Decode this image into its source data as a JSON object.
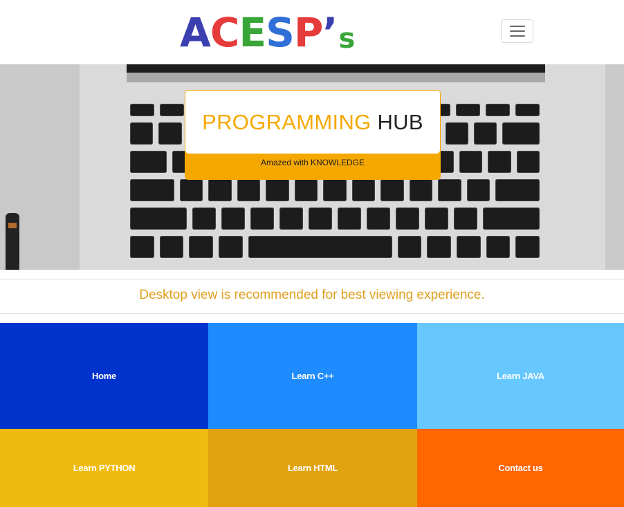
{
  "header": {
    "logo": {
      "letters": [
        {
          "char": "A",
          "color": "#3c3fb0"
        },
        {
          "char": "C",
          "color": "#e63b3b"
        },
        {
          "char": "E",
          "color": "#3aa63a"
        },
        {
          "char": "S",
          "color": "#2f6fd6"
        },
        {
          "char": "P",
          "color": "#e63b3b"
        },
        {
          "char": "’",
          "color": "#3c3fb0"
        },
        {
          "char": "s",
          "color": "#3aa63a"
        }
      ],
      "text": "ACESP’s"
    },
    "menu_icon": "hamburger-icon"
  },
  "hero": {
    "title_part1": "PROGRAMMING",
    "title_part2": "HUB",
    "subtitle": "Amazed with KNOWLEDGE"
  },
  "notice": {
    "text": "Desktop view is recommended for best viewing experience."
  },
  "tiles": [
    {
      "label": "Home",
      "color": "#0033cc"
    },
    {
      "label": "Learn C++",
      "color": "#1e8cff"
    },
    {
      "label": "Learn JAVA",
      "color": "#66c8ff"
    },
    {
      "label": "Learn PYTHON",
      "color": "#f0bb10"
    },
    {
      "label": "Learn HTML",
      "color": "#e1a210"
    },
    {
      "label": "Contact us",
      "color": "#ff6600"
    }
  ],
  "colors": {
    "accent": "#f5a800",
    "notice": "#e0a020"
  }
}
